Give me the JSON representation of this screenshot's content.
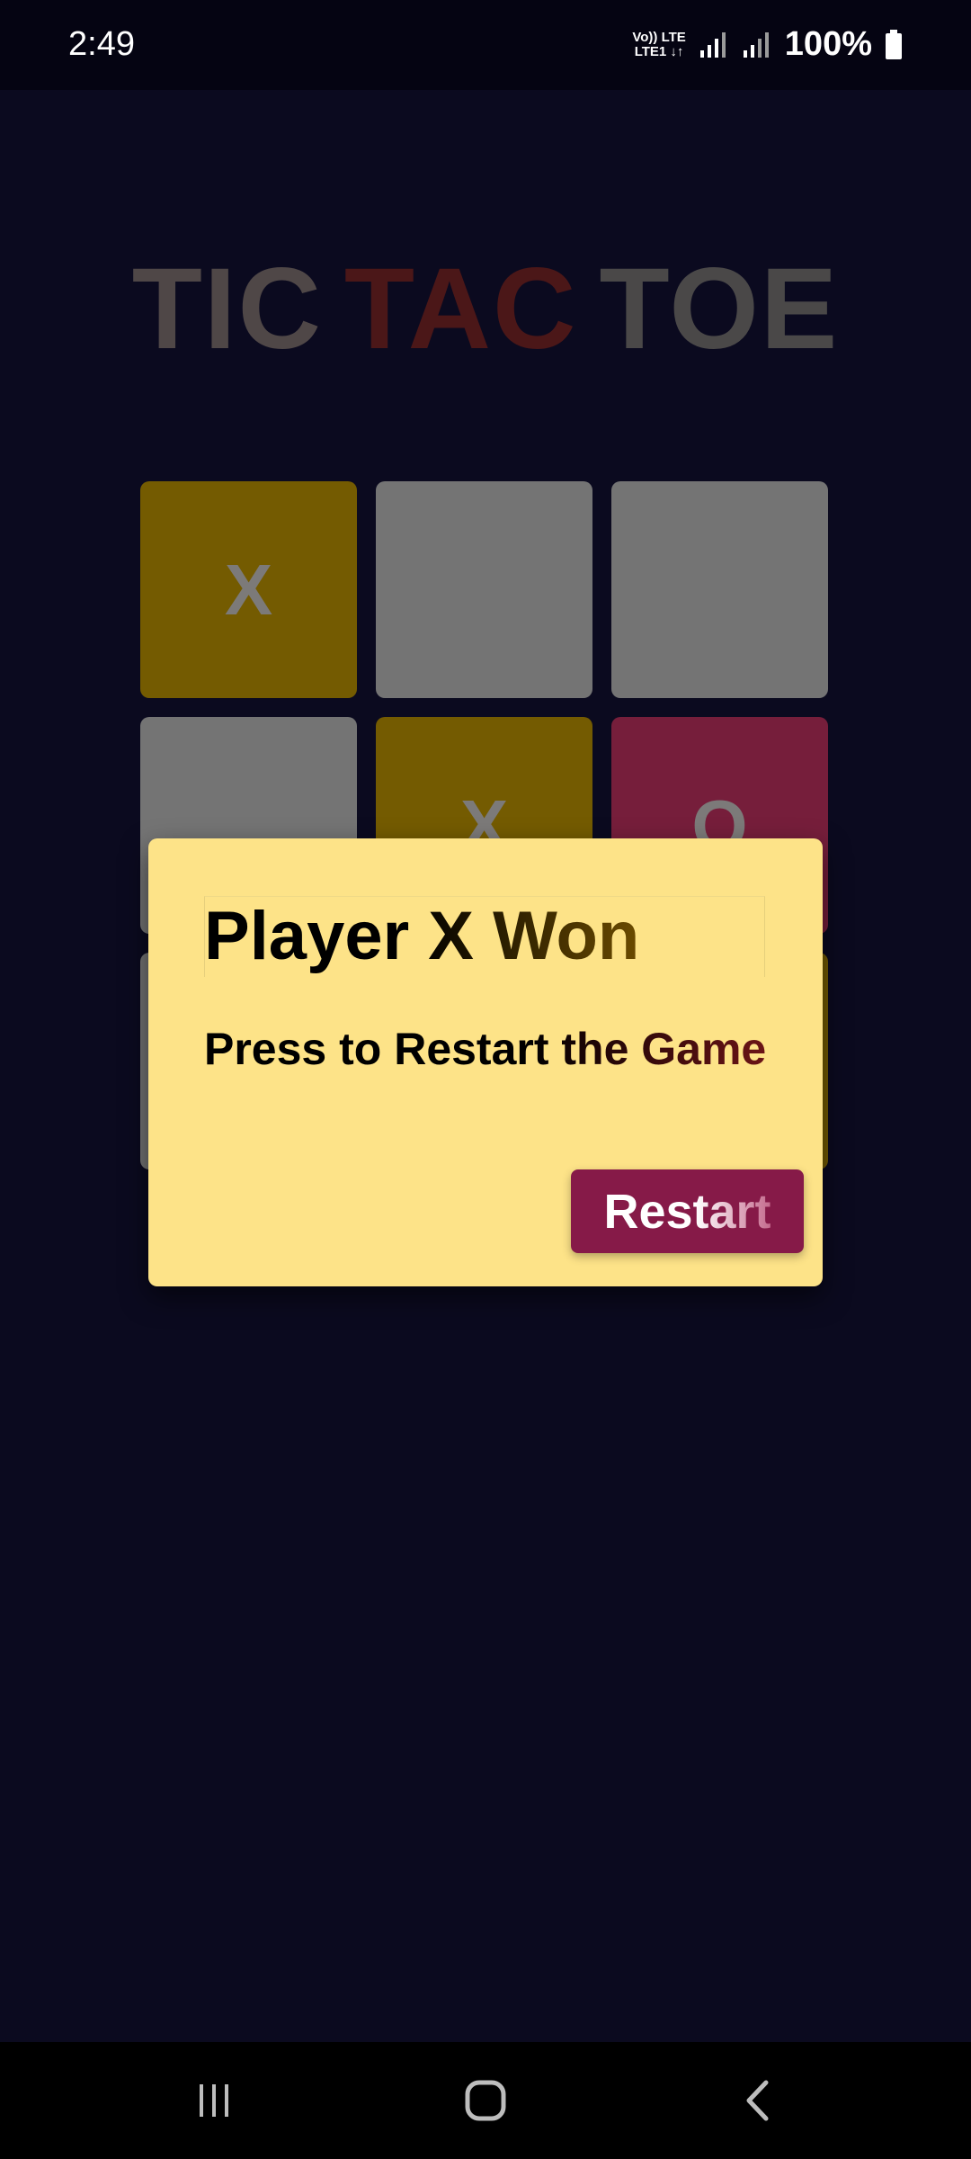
{
  "status_bar": {
    "time": "2:49",
    "network_top": "Vo)) LTE",
    "network_bottom": "LTE1 ↓↑",
    "battery": "100%"
  },
  "game": {
    "title_words": [
      "TIC",
      "TAC",
      "TOE"
    ],
    "board": [
      [
        "X",
        "",
        ""
      ],
      [
        "",
        "X",
        "O"
      ],
      [
        "",
        "",
        ""
      ]
    ]
  },
  "dialog": {
    "title": "Player X Won",
    "message": "Press to Restart the Game",
    "button_label": "Restart"
  },
  "colors": {
    "background": "#0b0a1f",
    "dialog_background": "#fde388",
    "restart_button": "#861a48",
    "cell_x": "#745b01",
    "cell_o": "#761e3b",
    "cell_empty": "#747474"
  },
  "icons": {
    "nav_recent": "recent-apps-icon",
    "nav_home": "home-icon",
    "nav_back": "back-icon"
  }
}
